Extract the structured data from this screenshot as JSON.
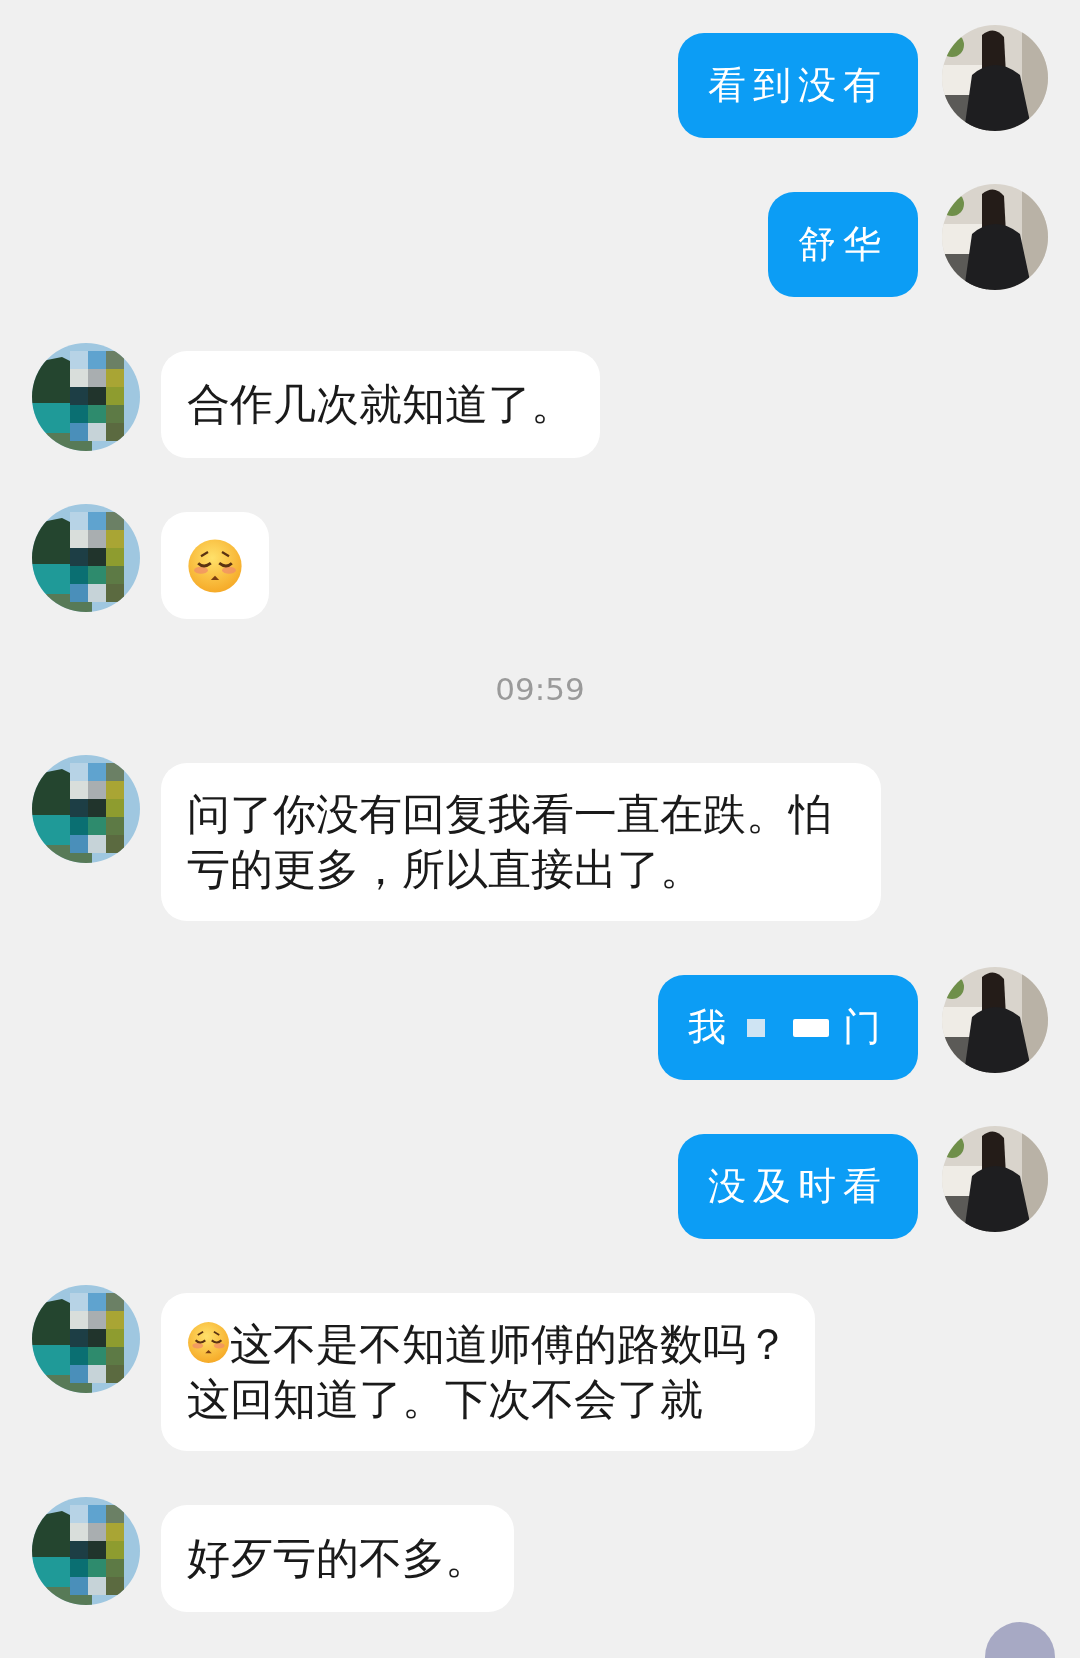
{
  "items": [
    {
      "kind": "message",
      "outgoing": true,
      "parts": [
        {
          "kind": "text",
          "text": "看到没有"
        }
      ]
    },
    {
      "kind": "message",
      "outgoing": true,
      "parts": [
        {
          "kind": "text",
          "text": "舒华"
        }
      ]
    },
    {
      "kind": "message",
      "outgoing": false,
      "parts": [
        {
          "kind": "text",
          "text": "合作几次就知道了。"
        }
      ]
    },
    {
      "kind": "message",
      "outgoing": false,
      "parts": [
        {
          "kind": "emoji"
        }
      ]
    },
    {
      "kind": "time",
      "text": "09:59"
    },
    {
      "kind": "message",
      "outgoing": false,
      "parts": [
        {
          "kind": "text",
          "text": "问了你没有回复我看一直在跌。怕亏的更多，所以直接出了。"
        }
      ]
    },
    {
      "kind": "message",
      "outgoing": true,
      "parts": [
        {
          "kind": "text",
          "text": "我"
        },
        {
          "kind": "redaction"
        },
        {
          "kind": "redaction"
        },
        {
          "kind": "text",
          "text": "门"
        }
      ]
    },
    {
      "kind": "message",
      "outgoing": true,
      "parts": [
        {
          "kind": "text",
          "text": "没及时看"
        }
      ]
    },
    {
      "kind": "message",
      "outgoing": false,
      "parts": [
        {
          "kind": "emoji"
        },
        {
          "kind": "text",
          "text": "这不是不知道师傅的路数吗？"
        },
        {
          "kind": "text",
          "text": "这回知道了。下次不会了就"
        }
      ]
    },
    {
      "kind": "message",
      "outgoing": false,
      "parts": [
        {
          "kind": "text",
          "text": "好歹亏的不多。"
        }
      ]
    }
  ]
}
